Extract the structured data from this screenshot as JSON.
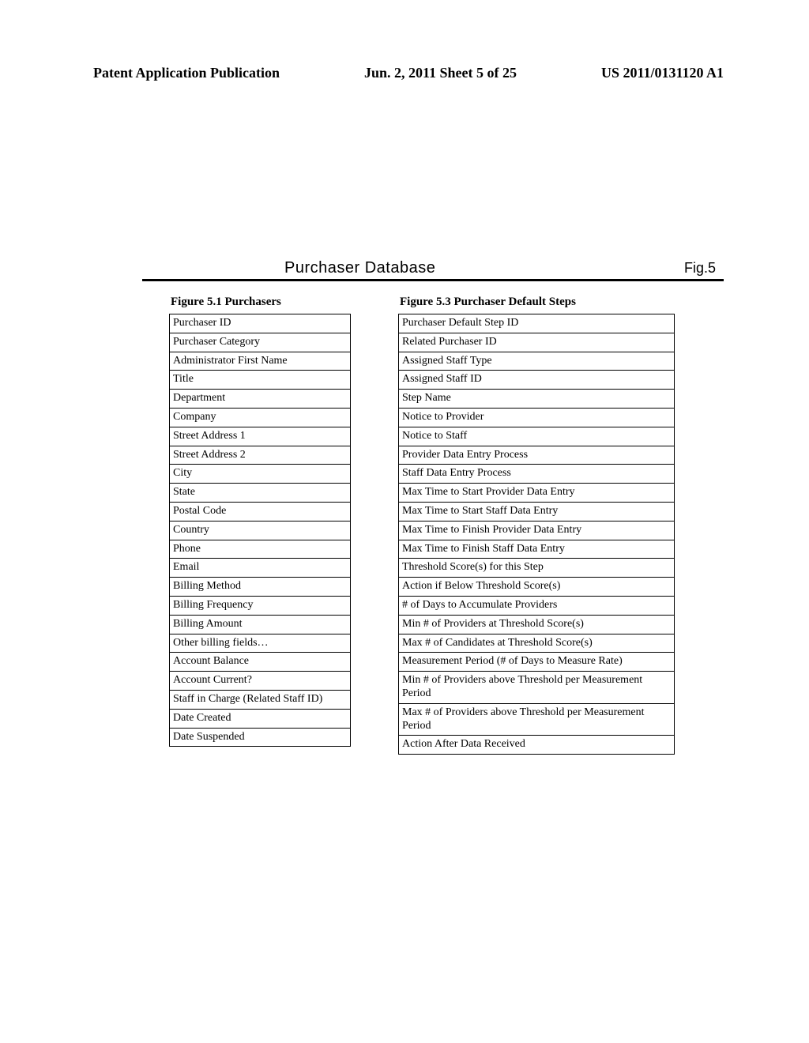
{
  "header": {
    "left": "Patent Application Publication",
    "center": "Jun. 2, 2011  Sheet 5 of 25",
    "right": "US 2011/0131120 A1"
  },
  "title_block": {
    "main_title": "Purchaser Database",
    "fig_label": "Fig.5"
  },
  "tables": {
    "left": {
      "caption": "Figure 5.1 Purchasers",
      "rows": [
        "Purchaser ID",
        "Purchaser Category",
        "Administrator First Name",
        "Title",
        "Department",
        "Company",
        "Street Address 1",
        "Street Address 2",
        "City",
        "State",
        "Postal Code",
        "Country",
        "Phone",
        "Email",
        "Billing Method",
        "Billing Frequency",
        "Billing Amount",
        "Other billing fields…",
        "Account Balance",
        "Account Current?",
        "Staff in Charge (Related Staff ID)",
        "Date Created",
        "Date Suspended"
      ]
    },
    "right": {
      "caption": "Figure 5.3 Purchaser Default Steps",
      "rows": [
        "Purchaser Default Step ID",
        "Related Purchaser ID",
        "Assigned Staff Type",
        "Assigned Staff ID",
        "Step Name",
        "Notice to Provider",
        "Notice to Staff",
        "Provider Data Entry Process",
        "Staff Data Entry Process",
        "Max Time to Start Provider Data Entry",
        "Max Time to Start Staff Data Entry",
        "Max Time to Finish Provider Data Entry",
        "Max Time to Finish Staff Data Entry",
        "Threshold Score(s) for this Step",
        "Action if Below Threshold Score(s)",
        "# of Days to Accumulate Providers",
        "Min # of Providers at Threshold Score(s)",
        "Max # of Candidates at Threshold Score(s)",
        "Measurement Period (# of Days to Measure Rate)",
        "Min # of Providers above Threshold per Measurement Period",
        "Max # of Providers above Threshold per Measurement Period",
        "Action After Data Received"
      ]
    }
  }
}
